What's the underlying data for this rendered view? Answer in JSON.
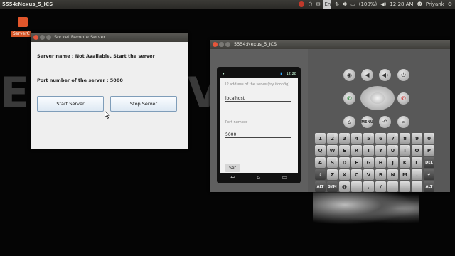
{
  "topbar": {
    "window_title": "5554:Nexus_5_ICS",
    "battery": "(100%)",
    "clock": "12:28 AM",
    "user": "Priyank",
    "keyboard_layout": "En"
  },
  "desktop": {
    "icon_label": "ServerC"
  },
  "socket_window": {
    "title": "Socket Remote Server",
    "server_name_text": "Server name : Not Available. Start the server",
    "port_text": "Port number of the server : 5000",
    "start_button": "Start Server",
    "stop_button": "Stop Server"
  },
  "emulator": {
    "title": "5554:Nexus_5_ICS",
    "status_time": "12:28",
    "ip_label": "IP address of the server(try ifconfig)",
    "ip_value": "localhost",
    "port_label": "Port number",
    "port_value": "5000",
    "set_button": "Set",
    "menu_label": "MENU",
    "keyboard_rows": [
      {
        "keys": [
          "1",
          "2",
          "3",
          "4",
          "5",
          "6",
          "7",
          "8",
          "9",
          "0"
        ],
        "alts": [
          "!",
          "@",
          "#",
          "$",
          "%",
          "^",
          "&",
          "*",
          "(",
          ")"
        ]
      },
      {
        "keys": [
          "Q",
          "W",
          "E",
          "R",
          "T",
          "Y",
          "U",
          "I",
          "O",
          "P"
        ],
        "alts": [
          "~",
          "\"",
          "{",
          "}",
          "[",
          "]",
          "<",
          ">",
          "-",
          "="
        ]
      },
      {
        "keys": [
          "A",
          "S",
          "D",
          "F",
          "G",
          "H",
          "J",
          "K",
          "L",
          "DEL"
        ],
        "alts": [
          "\\",
          "|",
          "/",
          "'",
          ":",
          ";",
          "`",
          "?",
          "+",
          ""
        ]
      },
      {
        "keys": [
          "⇧",
          "Z",
          "X",
          "C",
          "V",
          "B",
          "N",
          "M",
          ".",
          "↵"
        ],
        "alts": [
          "",
          "",
          "",
          "",
          "",
          "",
          "",
          "",
          ",",
          ""
        ]
      },
      {
        "keys": [
          "ALT",
          "SYM",
          "@",
          "",
          ",",
          "/",
          "",
          "",
          "",
          "ALT"
        ],
        "alts": [
          "",
          "",
          "",
          "",
          "",
          "",
          "",
          "",
          "",
          ""
        ]
      }
    ]
  }
}
